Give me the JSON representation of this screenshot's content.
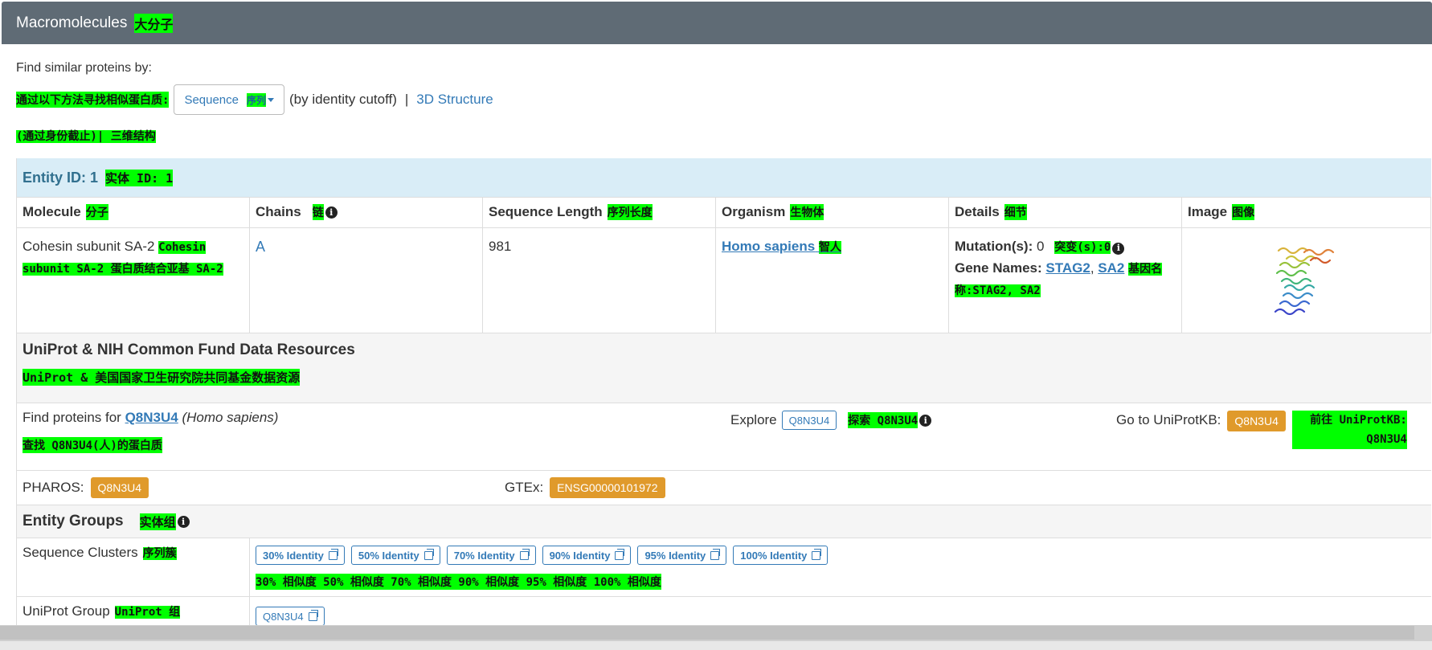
{
  "header": {
    "title": "Macromolecules",
    "title_zh": "大分子"
  },
  "find_similar": {
    "label": "Find similar proteins by:",
    "label_zh": "通过以下方法寻找相似蛋白质:",
    "dropdown_label": "Sequence",
    "dropdown_label_zh": "序列",
    "cutoff_text": "(by identity cutoff)",
    "separator": "|",
    "structure_link": "3D Structure",
    "sub_zh": "(通过身份截止)| 三维结构"
  },
  "entity": {
    "title": "Entity ID: 1",
    "title_zh": "实体 ID: 1",
    "columns": [
      {
        "label": "Molecule",
        "zh": "分子"
      },
      {
        "label": "Chains",
        "zh": "链"
      },
      {
        "label": "Sequence Length",
        "zh": "序列长度"
      },
      {
        "label": "Organism",
        "zh": "生物体"
      },
      {
        "label": "Details",
        "zh": "细节"
      },
      {
        "label": "Image",
        "zh": "图像"
      }
    ],
    "row": {
      "molecule": "Cohesin subunit SA-2",
      "molecule_zh": "Cohesin subunit SA-2 蛋白质结合亚基 SA-2",
      "chain": "A",
      "length": "981",
      "organism": "Homo sapiens",
      "organism_zh": "智人",
      "mutation_label": "Mutation(s):",
      "mutation_value": "0",
      "mutation_zh": "突变(s):0",
      "gene_label": "Gene Names:",
      "gene_1": "STAG2",
      "gene_sep": ",",
      "gene_2": "SA2",
      "gene_zh": "基因名称:STAG2, SA2"
    }
  },
  "uniprot": {
    "title": "UniProt & NIH Common Fund Data Resources",
    "title_zh": "UniProt & 美国国家卫生研究院共同基金数据资源",
    "find_prefix": "Find proteins for",
    "accession": "Q8N3U4",
    "species": "(Homo sapiens)",
    "find_zh": "查找 Q8N3U4(人)的蛋白质",
    "explore_label": "Explore",
    "explore_btn": "Q8N3U4",
    "explore_zh": "探索 Q8N3U4",
    "goto_label": "Go to UniProtKB:",
    "goto_btn": "Q8N3U4",
    "goto_zh": "前往 UniProtKB: Q8N3U4",
    "pharos_label": "PHAROS:",
    "pharos_btn": "Q8N3U4",
    "gtex_label": "GTEx:",
    "gtex_btn": "ENSG00000101972"
  },
  "groups": {
    "title": "Entity Groups",
    "title_zh": "实体组",
    "clusters_label": "Sequence Clusters",
    "clusters_zh": "序列簇",
    "clusters": [
      "30% Identity",
      "50% Identity",
      "70% Identity",
      "90% Identity",
      "95% Identity",
      "100% Identity"
    ],
    "clusters_text_zh": "30% 相似度 50% 相似度 70% 相似度 90% 相似度 95% 相似度 100% 相似度",
    "uniprot_group_label": "UniProt Group",
    "uniprot_group_zh": "UniProt 组",
    "uniprot_group_btn": "Q8N3U4"
  },
  "colors": {
    "header_bg": "#5f6b75",
    "entity_bg": "#d9edf7",
    "link": "#337ab7",
    "orange_btn": "#e09a2b",
    "highlight": "#00ff00"
  }
}
